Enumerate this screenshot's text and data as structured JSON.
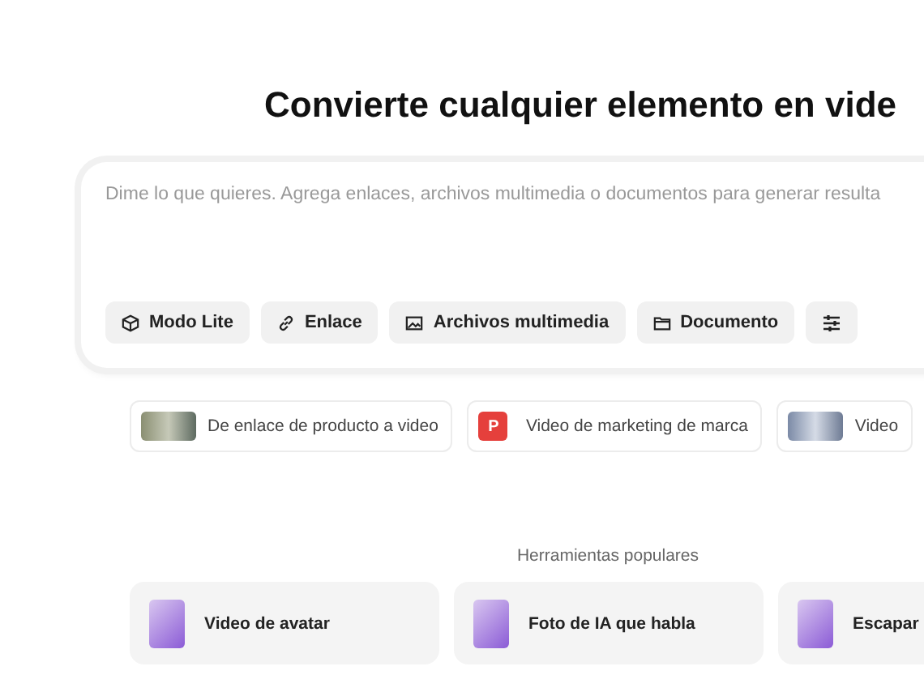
{
  "title": "Convierte cualquier elemento en vide",
  "prompt": {
    "placeholder": "Dime lo que quieres. Agrega enlaces, archivos multimedia o documentos para generar resulta",
    "actions": [
      {
        "kind": "mode",
        "label": "Modo Lite"
      },
      {
        "kind": "link",
        "label": "Enlace"
      },
      {
        "kind": "media",
        "label": "Archivos multimedia"
      },
      {
        "kind": "document",
        "label": "Documento"
      },
      {
        "kind": "settings"
      }
    ]
  },
  "suggestions": [
    {
      "kind": "photo",
      "label": "De enlace de producto a video"
    },
    {
      "kind": "logo",
      "logo": "P",
      "label": "Video de marketing de marca"
    },
    {
      "kind": "photo",
      "label": "Video"
    }
  ],
  "popular_tools": {
    "heading": "Herramientas populares",
    "items": [
      {
        "label": "Video de avatar"
      },
      {
        "label": "Foto de IA que habla"
      },
      {
        "label": "Escapar"
      }
    ]
  }
}
